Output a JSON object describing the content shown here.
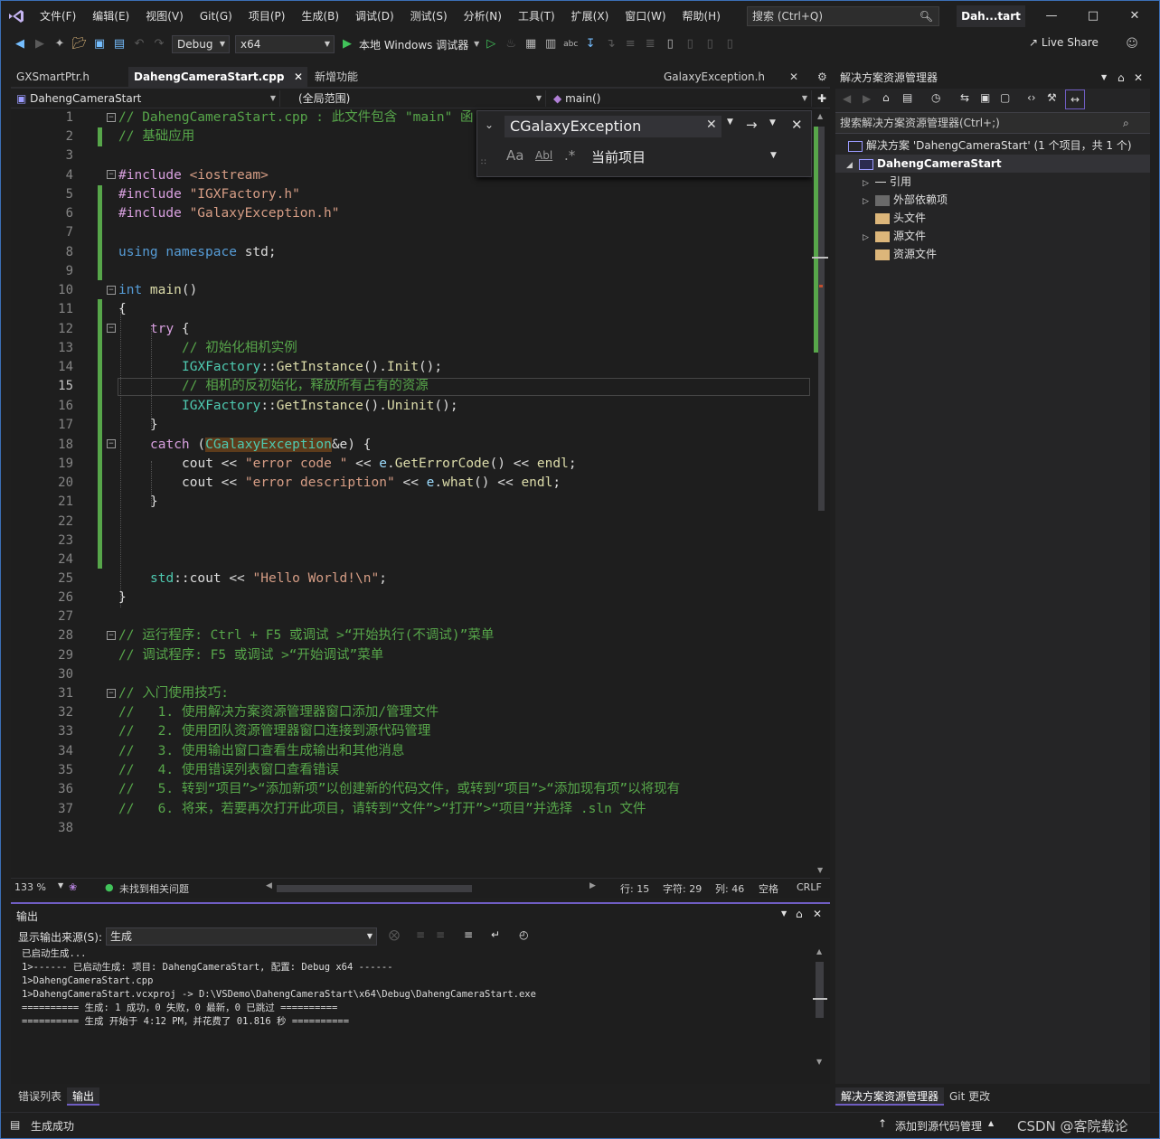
{
  "menu": [
    "文件(F)",
    "编辑(E)",
    "视图(V)",
    "Git(G)",
    "项目(P)",
    "生成(B)",
    "调试(D)",
    "测试(S)",
    "分析(N)",
    "工具(T)",
    "扩展(X)",
    "窗口(W)",
    "帮助(H)"
  ],
  "search": {
    "placeholder": "搜索 (Ctrl+Q)"
  },
  "title_badge": "Dah...tart",
  "toolbar": {
    "config": "Debug",
    "platform": "x64",
    "run_label": "本地 Windows 调试器",
    "live_share": "Live Share"
  },
  "tabs": {
    "left": [
      "GXSmartPtr.h",
      "DahengCameraStart.cpp",
      "新增功能"
    ],
    "right": "GalaxyException.h"
  },
  "nav": {
    "project": "DahengCameraStart",
    "scope": "(全局范围)",
    "member": "main()"
  },
  "find": {
    "value": "CGalaxyException",
    "scope": "当前项目",
    "opt_case": "Aa",
    "opt_word": "Abl",
    "opt_regex": ".*"
  },
  "code_lines": [
    "1",
    "2",
    "3",
    "4",
    "5",
    "6",
    "7",
    "8",
    "9",
    "10",
    "11",
    "12",
    "13",
    "14",
    "15",
    "16",
    "17",
    "18",
    "19",
    "20",
    "21",
    "22",
    "23",
    "24",
    "25",
    "26",
    "27",
    "28",
    "29",
    "30",
    "31",
    "32",
    "33",
    "34",
    "35",
    "36",
    "37",
    "38"
  ],
  "code": {
    "l1": "// DahengCameraStart.cpp : 此文件包含 \"main\" 函",
    "l2": "// 基础应用",
    "l4a": "#include ",
    "l4b": "<iostream>",
    "l5a": "#include ",
    "l5b": "\"IGXFactory.h\"",
    "l6a": "#include ",
    "l6b": "\"GalaxyException.h\"",
    "l8a": "using ",
    "l8b": "namespace ",
    "l8c": "std;",
    "l10a": "int ",
    "l10b": "main",
    "l10c": "()",
    "l11": "{",
    "l12a": "try ",
    "l12b": "{",
    "l13": "// 初始化相机实例",
    "l14a": "IGXFactory",
    "l14b": "::",
    "l14c": "GetInstance",
    "l14d": "().",
    "l14e": "Init",
    "l14f": "();",
    "l15": "// 相机的反初始化，释放所有占有的资源",
    "l16a": "IGXFactory",
    "l16b": "::",
    "l16c": "GetInstance",
    "l16d": "().",
    "l16e": "Uninit",
    "l16f": "();",
    "l17": "}",
    "l18a": "catch ",
    "l18b": "(",
    "l18c": "CGalaxyException",
    "l18d": "&e",
    ") ": "",
    "l18e": ") {",
    "l19a": "cout ",
    "l19b": "<< ",
    "l19c": "\"error code \"",
    "l19d": " << ",
    "l19e": "e",
    "l19f": ".",
    "l19g": "GetErrorCode",
    "l19h": "() << ",
    "l19i": "endl",
    ";": ";",
    "l19j": ";",
    "l20a": "cout ",
    "l20b": "<< ",
    "l20c": "\"error description\"",
    "l20d": " << ",
    "l20e": "e",
    "l20f": ".",
    "l20g": "what",
    "l20h": "() << ",
    "l20i": "endl",
    "l20j": ";",
    "l21": "}",
    "l25a": "std",
    "l25b": "::",
    "l25c": "cout ",
    "l25d": "<< ",
    "l25e": "\"Hello World!\\n\"",
    "l25f": ";",
    "l26": "}",
    "l28": "// 运行程序: Ctrl + F5 或调试 >“开始执行(不调试)”菜单",
    "l29": "// 调试程序: F5 或调试 >“开始调试”菜单",
    "l31": "// 入门使用技巧: ",
    "l32": "//   1. 使用解决方案资源管理器窗口添加/管理文件",
    "l33": "//   2. 使用团队资源管理器窗口连接到源代码管理",
    "l34": "//   3. 使用输出窗口查看生成输出和其他消息",
    "l35": "//   4. 使用错误列表窗口查看错误",
    "l36": "//   5. 转到“项目”>“添加新项”以创建新的代码文件，或转到“项目”>“添加现有项”以将现有",
    "l37": "//   6. 将来，若要再次打开此项目，请转到“文件”>“打开”>“项目”并选择 .sln 文件"
  },
  "editor_status": {
    "zoom": "133 %",
    "issues": "未找到相关问题",
    "line": "行: 15",
    "char": "字符: 29",
    "col": "列: 46",
    "ws": "空格",
    "eol": "CRLF"
  },
  "output": {
    "title": "输出",
    "source_label": "显示输出来源(S):",
    "source_value": "生成",
    "lines": [
      "已启动生成...",
      "1>------ 已启动生成: 项目: DahengCameraStart, 配置: Debug x64 ------",
      "1>DahengCameraStart.cpp",
      "1>DahengCameraStart.vcxproj -> D:\\VSDemo\\DahengCameraStart\\x64\\Debug\\DahengCameraStart.exe",
      "========== 生成: 1 成功，0 失败，0 最新，0 已跳过 ==========",
      "========== 生成 开始于 4:12 PM，并花费了 01.816 秒 =========="
    ]
  },
  "bottom_tabs": [
    "错误列表",
    "输出"
  ],
  "solution": {
    "title": "解决方案资源管理器",
    "search": "搜索解决方案资源管理器(Ctrl+;)",
    "root": "解决方案 'DahengCameraStart' (1 个项目，共 1 个)",
    "project": "DahengCameraStart",
    "items": [
      "引用",
      "外部依赖项",
      "头文件",
      "源文件",
      "资源文件"
    ],
    "tabs": [
      "解决方案资源管理器",
      "Git 更改"
    ]
  },
  "statusbar": {
    "left": "生成成功",
    "add_source": "添加到源代码管理",
    "watermark": "CSDN @客院载论"
  }
}
